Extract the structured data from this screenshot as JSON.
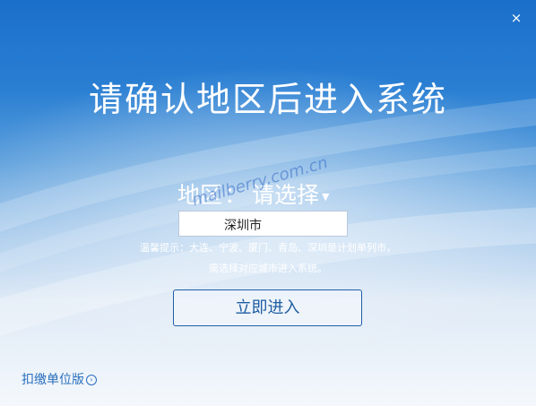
{
  "window": {
    "close_symbol": "×"
  },
  "main": {
    "title": "请确认地区后进入系统",
    "region_label": "地区",
    "region_colon": "：",
    "region_select_text": "请选择",
    "city_input_value": "深圳市",
    "watermark": "mailberry.com.cn",
    "tip_line1": "温馨提示：大连、宁波、厦门、青岛、深圳是计划单列市，",
    "tip_line2": "需选择对应城市进入系统。",
    "enter_button": "立即进入",
    "version_link": "扣缴单位版"
  },
  "icons": {
    "close": "close-icon",
    "dropdown": "chevron-down-icon",
    "link_arrow": "circle-arrow-right-icon"
  },
  "colors": {
    "background_top": "#1a6fca",
    "background_bottom": "#f4f8fc",
    "button_text": "#1d5da3",
    "link_text": "#2a6fbd"
  }
}
